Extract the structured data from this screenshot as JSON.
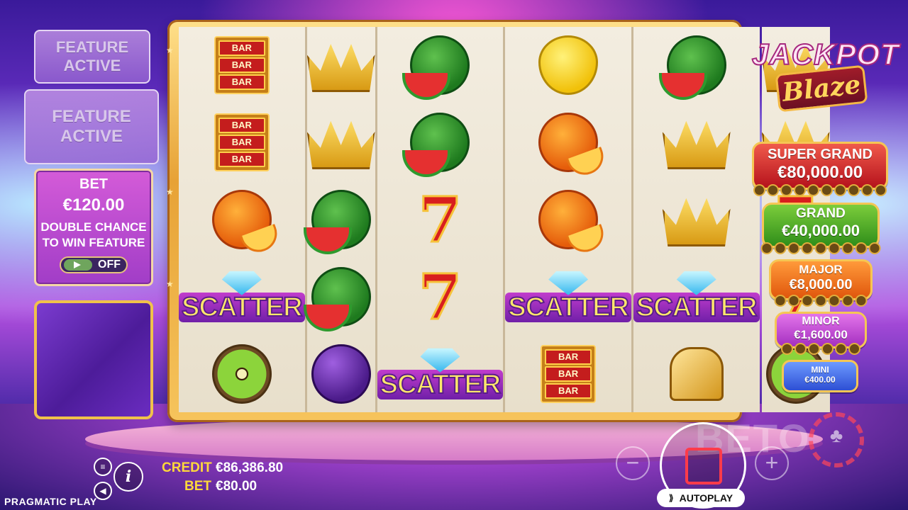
{
  "left_panel": {
    "feature_1": "FEATURE ACTIVE",
    "feature_2": "FEATURE ACTIVE",
    "bet_title": "BET",
    "bet_value": "€120.00",
    "bet_desc": "DOUBLE CHANCE TO WIN FEATURE",
    "toggle_state": "OFF"
  },
  "reels": [
    [
      "bar",
      "bar",
      "orange",
      "scatter",
      "kiwi"
    ],
    [
      "crown",
      "crown",
      "watermelon",
      "watermelon",
      "plum"
    ],
    [
      "watermelon",
      "watermelon",
      "seven",
      "seven",
      "scatter"
    ],
    [
      "lemon",
      "orange",
      "orange",
      "scatter",
      "bar"
    ],
    [
      "watermelon",
      "crown",
      "crown",
      "scatter",
      "bell"
    ],
    [
      "crown",
      "crown",
      "seven",
      "seven",
      "kiwi"
    ]
  ],
  "symbols": {
    "bar_label": "BAR",
    "seven_label": "7",
    "scatter_label": "SCATTER"
  },
  "logo": {
    "line1": "JACKPOT",
    "line2": "Blaze"
  },
  "jackpots": {
    "super_grand": {
      "name": "SUPER GRAND",
      "amount": "€80,000.00",
      "dots": 10,
      "color": "#c8192a"
    },
    "grand": {
      "name": "GRAND",
      "amount": "€40,000.00",
      "dots": 9,
      "color": "#3a9a1f"
    },
    "major": {
      "name": "MAJOR",
      "amount": "€8,000.00",
      "dots": 7,
      "color": "#f06a16"
    },
    "minor": {
      "name": "MINOR",
      "amount": "€1,600.00",
      "dots": 6,
      "color": "#b53ec8"
    },
    "mini": {
      "name": "MINI",
      "amount": "€400.00",
      "dots": 0,
      "color": "#3b60e0"
    }
  },
  "bottom": {
    "credit_label": "CREDIT",
    "credit_value": "€86,386.80",
    "bet_label": "BET",
    "bet_value": "€80.00",
    "brand": "PRAGMATIC PLAY",
    "minus": "−",
    "plus": "+",
    "autoplay": "AUTOPLAY",
    "menu_icon": "menu-icon",
    "sound_icon": "sound-icon",
    "info_icon": "info-icon"
  },
  "watermark": "BETO"
}
